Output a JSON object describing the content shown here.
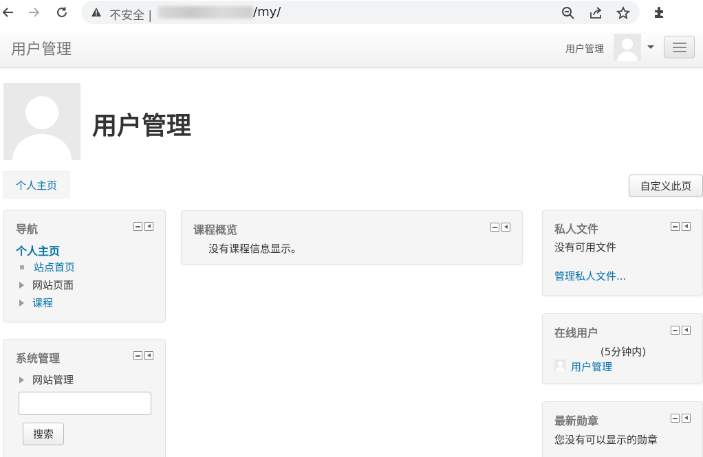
{
  "browser": {
    "insecure_label": "不安全 |",
    "url_path": "/my/"
  },
  "header": {
    "brand": "用户管理",
    "user_name": "用户管理"
  },
  "page": {
    "title": "用户管理",
    "tab_home": "个人主页",
    "customize_button": "自定义此页"
  },
  "nav_block": {
    "title": "导航",
    "home": "个人主页",
    "items": [
      "站点首页",
      "网站页面",
      "课程"
    ]
  },
  "admin_block": {
    "title": "系统管理",
    "site_admin": "网站管理",
    "search_value": "",
    "search_button": "搜索"
  },
  "course_block": {
    "title": "课程概览",
    "empty_text": "没有课程信息显示。"
  },
  "files_block": {
    "title": "私人文件",
    "empty_text": "没有可用文件",
    "manage_link": "管理私人文件..."
  },
  "online_block": {
    "title": "在线用户",
    "period": "(5分钟内)",
    "user": "用户管理"
  },
  "badges_block": {
    "title": "最新勋章",
    "empty_text": "您没有可以显示的勋章"
  }
}
